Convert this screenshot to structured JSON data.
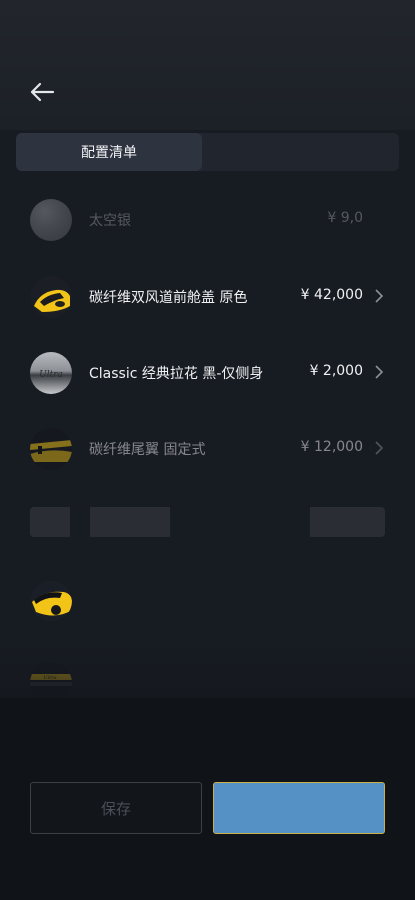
{
  "tabs": [
    {
      "label": "配置清单"
    },
    {
      "label": ""
    }
  ],
  "items": [
    {
      "name": "太空银",
      "price": "¥ 9,0",
      "show_chevron": false
    },
    {
      "name": "碳纤维双风道前舱盖 原色",
      "price": "¥ 42,000",
      "show_chevron": true
    },
    {
      "name": "Classic 经典拉花 黑-仅侧身",
      "price": "¥ 2,000",
      "show_chevron": true
    },
    {
      "name": "碳纤维尾翼 固定式",
      "price": "¥ 12,000",
      "show_chevron": true
    }
  ],
  "footer": {
    "secondary_label": "保存",
    "primary_label": ""
  },
  "colors": {
    "background": "#171b22",
    "primary_button": "#5591c4",
    "primary_border": "#c9b04a",
    "accent_yellow": "#f2c417"
  }
}
